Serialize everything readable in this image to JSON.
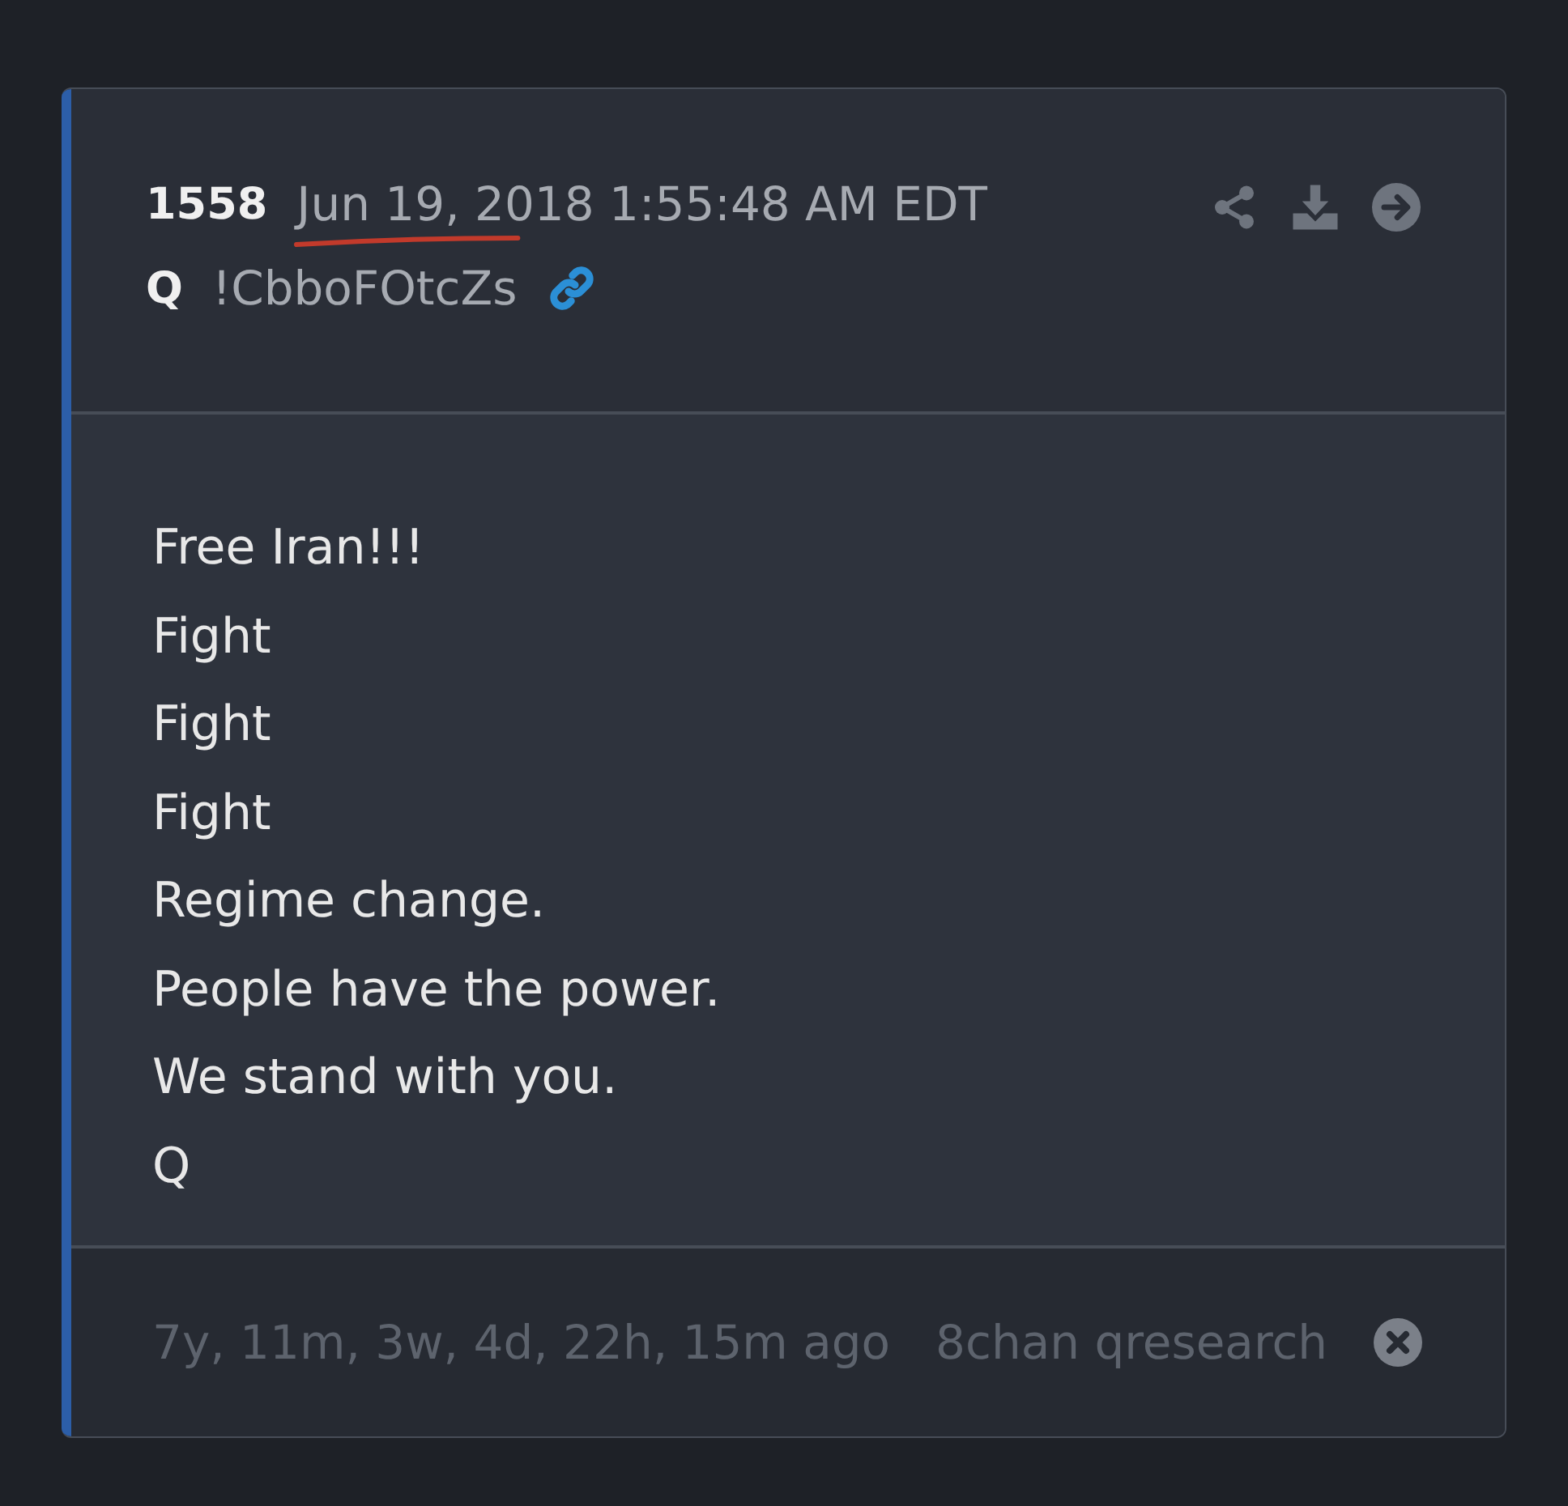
{
  "post": {
    "number": "1558",
    "date": {
      "text": "Jun 19, 2018 1:55:48 AM EDT",
      "underlined": true
    },
    "author": "Q",
    "tripcode": "!CbboFOtcZs"
  },
  "body": {
    "lines": [
      "Free Iran!!!",
      "Fight",
      "Fight",
      "Fight",
      "Regime change.",
      "People have the power.",
      "We stand with you.",
      "Q"
    ]
  },
  "footer": {
    "age": "7y, 11m, 3w, 4d, 22h, 15m ago",
    "source": "8chan qresearch"
  }
}
